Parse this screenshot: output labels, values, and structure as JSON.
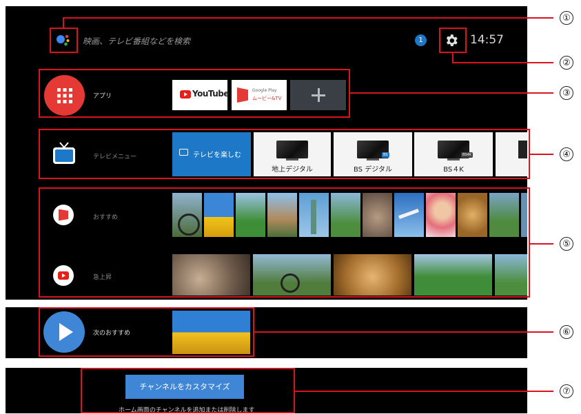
{
  "header": {
    "search_placeholder": "映画、テレビ番組などを検索",
    "notification_count": "1",
    "clock": "14:57"
  },
  "rows": {
    "apps": {
      "label": "アプリ",
      "youtube": "YouTube",
      "play_line1": "Google Play",
      "play_line2": "ムービー&TV"
    },
    "tv_menu": {
      "label": "テレビメニュー",
      "tiles": [
        {
          "label": "テレビを楽しむ"
        },
        {
          "label": "地上デジタル"
        },
        {
          "label": "BS デジタル",
          "badge": "BS"
        },
        {
          "label": "BS４K",
          "badge": "BS4K"
        }
      ]
    },
    "recommend": {
      "label": "おすすめ"
    },
    "trending": {
      "label": "急上昇"
    },
    "play_next": {
      "label": "次のおすすめ"
    }
  },
  "customize": {
    "button": "チャンネルをカスタマイズ",
    "note": "ホーム画面のチャンネルを追加または削除します"
  },
  "callouts": [
    "①",
    "②",
    "③",
    "④",
    "⑤",
    "⑥",
    "⑦"
  ],
  "colors": {
    "accent_red": "#d9141f",
    "app_circle": "#e53935",
    "tv_blue": "#1e78c8",
    "play_blue": "#3f86d6"
  }
}
